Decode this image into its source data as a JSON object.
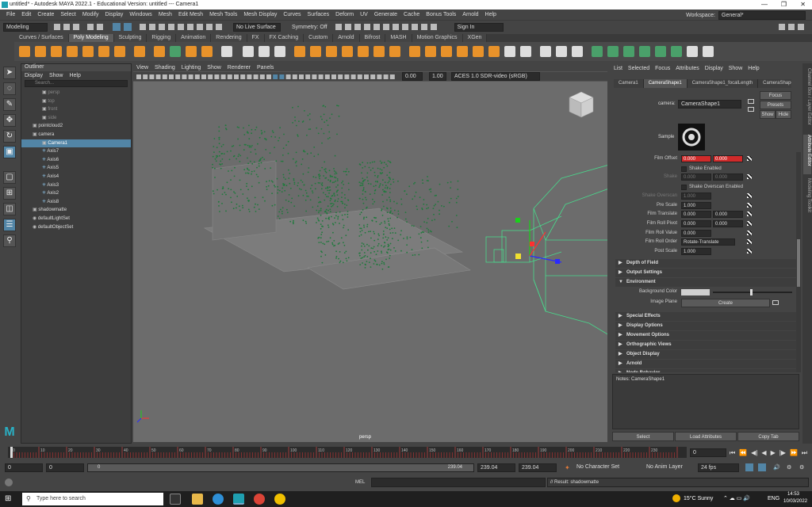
{
  "window": {
    "title": "untitled* - Autodesk MAYA 2022.1 - Educational Version: untitled  ---  Camera1",
    "controls": [
      "—",
      "❐",
      "✕"
    ]
  },
  "menubar": {
    "items": [
      "File",
      "Edit",
      "Create",
      "Select",
      "Modify",
      "Display",
      "Windows",
      "Mesh",
      "Edit Mesh",
      "Mesh Tools",
      "Mesh Display",
      "Curves",
      "Surfaces",
      "Deform",
      "UV",
      "Generate",
      "Cache",
      "Bonus Tools",
      "Arnold",
      "Help"
    ],
    "workspace_label": "Workspace:",
    "workspace_value": "General*"
  },
  "statusline": {
    "mode": "Modeling",
    "live_surface": "No Live Surface",
    "symmetry": "Symmetry: Off",
    "sign_in": "Sign In"
  },
  "shelf": {
    "tabs": [
      "Curves / Surfaces",
      "Poly Modeling",
      "Sculpting",
      "Rigging",
      "Animation",
      "Rendering",
      "FX",
      "FX Caching",
      "Custom",
      "Arnold",
      "Bifrost",
      "MASH",
      "Motion Graphics",
      "XGen"
    ],
    "active_tab": "Poly Modeling"
  },
  "outliner": {
    "title": "Outliner",
    "menu": [
      "Display",
      "Show",
      "Help"
    ],
    "search_placeholder": "Search...",
    "items": [
      {
        "label": "persp",
        "dim": true,
        "indent": 1
      },
      {
        "label": "top",
        "dim": true,
        "indent": 1
      },
      {
        "label": "front",
        "dim": true,
        "indent": 1
      },
      {
        "label": "side",
        "dim": true,
        "indent": 1
      },
      {
        "label": "pointcloud2",
        "dim": false,
        "indent": 0
      },
      {
        "label": "camera",
        "dim": false,
        "indent": 0
      },
      {
        "label": "Camera1",
        "dim": false,
        "indent": 1,
        "selected": true
      },
      {
        "label": "Axis7",
        "dim": false,
        "indent": 1
      },
      {
        "label": "Axis6",
        "dim": false,
        "indent": 1
      },
      {
        "label": "Axis5",
        "dim": false,
        "indent": 1
      },
      {
        "label": "Axis4",
        "dim": false,
        "indent": 1
      },
      {
        "label": "Axis3",
        "dim": false,
        "indent": 1
      },
      {
        "label": "Axis2",
        "dim": false,
        "indent": 1
      },
      {
        "label": "Axis8",
        "dim": false,
        "indent": 1
      },
      {
        "label": "shadowmatte",
        "dim": false,
        "indent": 0
      },
      {
        "label": "defaultLightSet",
        "dim": false,
        "indent": 0
      },
      {
        "label": "defaultObjectSet",
        "dim": false,
        "indent": 0
      }
    ]
  },
  "viewport": {
    "menu": [
      "View",
      "Shading",
      "Lighting",
      "Show",
      "Renderer",
      "Panels"
    ],
    "exposure": "0.00",
    "gamma": "1.00",
    "colorspace": "ACES 1.0 SDR-video (sRGB)",
    "camera_label": "persp"
  },
  "attribute_editor": {
    "menu": [
      "List",
      "Selected",
      "Focus",
      "Attributes",
      "Display",
      "Show",
      "Help"
    ],
    "tabs": [
      "Camera1",
      "CameraShape1",
      "CameraShape1_focalLength",
      "CameraShape"
    ],
    "active_tab": "CameraShape1",
    "camera_label": "camera:",
    "camera_value": "CameraShape1",
    "buttons": {
      "focus": "Focus",
      "presets": "Presets",
      "show": "Show",
      "hide": "Hide"
    },
    "sample_label": "Sample",
    "rows": [
      {
        "label": "Film Offset",
        "v1": "0.000",
        "v2": "0.000",
        "red": true
      },
      {
        "check": "Shake Enabled"
      },
      {
        "label": "Shake",
        "v1": "0.000",
        "v2": "0.000",
        "dim": true
      },
      {
        "check": "Shake Overscan Enabled"
      },
      {
        "label": "Shake Overscan",
        "v1": "1.000",
        "dim": true
      },
      {
        "label": "Pre Scale",
        "v1": "1.000"
      },
      {
        "label": "Film Translate",
        "v1": "0.000",
        "v2": "0.000"
      },
      {
        "label": "Film Roll Pivot",
        "v1": "0.000",
        "v2": "0.000"
      },
      {
        "label": "Film Roll Value",
        "v1": "0.000"
      },
      {
        "label": "Film Roll Order",
        "v1": "Rotate-Translate"
      },
      {
        "label": "Post Scale",
        "v1": "1.000"
      }
    ],
    "sections_a": [
      "Depth of Field",
      "Output Settings"
    ],
    "environment": "Environment",
    "bg_color_label": "Background Color",
    "image_plane_label": "Image Plane",
    "create_label": "Create",
    "sections_b": [
      "Special Effects",
      "Display Options",
      "Movement Options",
      "Orthographic Views",
      "Object Display",
      "Arnold",
      "Node Behavior"
    ],
    "notes_label": "Notes:  CameraShape1",
    "bottom_buttons": [
      "Select",
      "Load Attributes",
      "Copy Tab"
    ],
    "side_tabs": [
      "Channel Box / Layer Editor",
      "Attribute Editor",
      "Modeling Toolkit"
    ]
  },
  "timeline": {
    "ticks": [
      "0",
      "10",
      "20",
      "30",
      "40",
      "50",
      "60",
      "70",
      "80",
      "90",
      "100",
      "110",
      "120",
      "130",
      "140",
      "150",
      "160",
      "170",
      "180",
      "190",
      "200",
      "210",
      "220",
      "230"
    ],
    "current_frame": "0"
  },
  "range": {
    "start": "0",
    "inner_start": "0",
    "slider_start": "0",
    "slider_end": "239.04",
    "end1": "239.04",
    "end2": "239.04",
    "character_set": "No Character Set",
    "anim_layer": "No Anim Layer",
    "fps": "24 fps"
  },
  "command_line": {
    "lang": "MEL",
    "result": "// Result: shadowmatte"
  },
  "taskbar": {
    "search_placeholder": "Type here to search",
    "weather": "15°C  Sunny",
    "lang": "ENG",
    "time": "14:53",
    "date": "10/03/2022"
  },
  "colors": {
    "accent": "#5285a6",
    "point_cloud": "#1f7a3c",
    "wireframe": "#49d98c",
    "highlight_red": "#d02a2a"
  }
}
